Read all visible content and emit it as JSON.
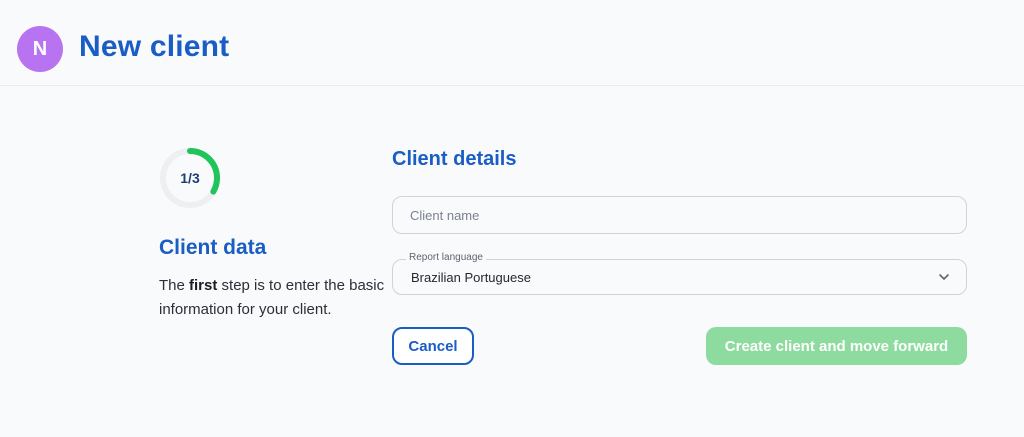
{
  "header": {
    "avatar_initial": "N",
    "title": "New client"
  },
  "progress": {
    "label": "1/3",
    "fraction": 0.3333,
    "color": "#1fc45a",
    "track_color": "#eeeff2"
  },
  "step": {
    "title": "Client data",
    "desc_prefix": "The ",
    "desc_bold": "first",
    "desc_suffix": " step is to enter the basic information for your client."
  },
  "form": {
    "section_title": "Client details",
    "client_name": {
      "placeholder": "Client name",
      "value": ""
    },
    "report_language": {
      "label": "Report language",
      "value": "Brazilian Portuguese"
    }
  },
  "actions": {
    "cancel_label": "Cancel",
    "create_label": "Create client and move forward"
  },
  "colors": {
    "accent": "#1a5dc4",
    "avatar": "#b874f0",
    "success_disabled": "#8edb9f"
  },
  "icons": {
    "dropdown": "chevron-down-icon"
  }
}
